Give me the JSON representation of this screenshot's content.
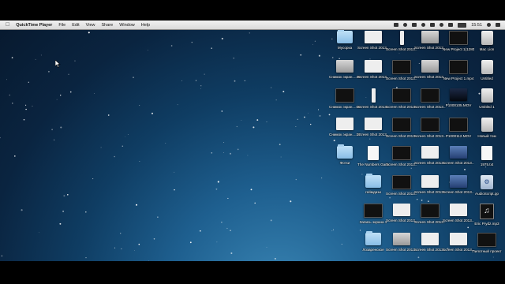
{
  "menubar": {
    "apple_icon": "apple-icon",
    "app_name": "QuickTime Player",
    "items": [
      "File",
      "Edit",
      "View",
      "Share",
      "Window",
      "Help"
    ],
    "clock": "15:51"
  },
  "desktop": {
    "icons": [
      {
        "label": "Мусорка",
        "kind": "folder"
      },
      {
        "label": "Screen Shot 2013....41.09",
        "kind": "white"
      },
      {
        "label": "Screen Shot 2013....12.19",
        "kind": "tall"
      },
      {
        "label": "Screen Shot 2013....31.47",
        "kind": "grey"
      },
      {
        "label": "New Project 1(1280....).mp4",
        "kind": "dark"
      },
      {
        "label": "Mac Lion",
        "kind": "drive"
      },
      {
        "label": "Снимок экран....49.16",
        "kind": "grey"
      },
      {
        "label": "Screen Shot 2013....41.32",
        "kind": "white"
      },
      {
        "label": "Screen Shot 2013....12.25",
        "kind": "dark"
      },
      {
        "label": "Screen Shot 2013....41.09",
        "kind": "grey"
      },
      {
        "label": "New Project 1.mp4",
        "kind": "dark"
      },
      {
        "label": "Untitled",
        "kind": "drive"
      },
      {
        "label": "Снимок экран....00.24",
        "kind": "dark"
      },
      {
        "label": "Screen Shot 2013....41.53",
        "kind": "tall"
      },
      {
        "label": "Screen Shot 2013....25.14",
        "kind": "dark"
      },
      {
        "label": "Screen Shot 2013....09.03",
        "kind": "dark"
      },
      {
        "label": "P1000105.MOV",
        "kind": "star"
      },
      {
        "label": "Untitled 1",
        "kind": "drive"
      },
      {
        "label": "Снимок экран....17.35",
        "kind": "white"
      },
      {
        "label": "Screen Shot 2013....37.31",
        "kind": "white"
      },
      {
        "label": "Screen Shot 2013....25.27",
        "kind": "dark"
      },
      {
        "label": "Screen Shot 2013....09.23",
        "kind": "dark"
      },
      {
        "label": "P1000112.MOV",
        "kind": "dark"
      },
      {
        "label": "Новый том",
        "kind": "drive"
      },
      {
        "label": "Фотки",
        "kind": "folder"
      },
      {
        "label": "The Numbers Game.logic",
        "kind": "doc"
      },
      {
        "label": "Screen Shot 2013....37.19",
        "kind": "dark"
      },
      {
        "label": "Screen Shot 2013....05.02",
        "kind": "white"
      },
      {
        "label": "Screen Shot 2013....29.08",
        "kind": "blue"
      },
      {
        "label": "1975.txt",
        "kind": "doc"
      },
      {
        "label": "",
        "kind": "none"
      },
      {
        "label": "геймдизи",
        "kind": "folder"
      },
      {
        "label": "Screen Shot 2013....09.33",
        "kind": "dark"
      },
      {
        "label": "Screen Shot 2013....04.03",
        "kind": "white"
      },
      {
        "label": "Screen Shot 2013....28.22",
        "kind": "blue"
      },
      {
        "label": "AudioScript.pp",
        "kind": "script"
      },
      {
        "label": "",
        "kind": "none"
      },
      {
        "label": "Запись экрана 1",
        "kind": "dark"
      },
      {
        "label": "Screen Shot 2013....36.21",
        "kind": "white"
      },
      {
        "label": "Screen Shot 2013....19.45",
        "kind": "dark"
      },
      {
        "label": "Screen Shot 2013....12.37",
        "kind": "white"
      },
      {
        "label": "Eric Prydz.mp3",
        "kind": "music"
      },
      {
        "label": "",
        "kind": "none"
      },
      {
        "label": "Лозаренское",
        "kind": "folder"
      },
      {
        "label": "Screen Shot 2013....32.03",
        "kind": "grey"
      },
      {
        "label": "Screen Shot 2013....12.04",
        "kind": "white"
      },
      {
        "label": "Screen Shot 2013....",
        "kind": "white"
      },
      {
        "label": "Пилотный проект",
        "kind": "dark"
      }
    ]
  }
}
